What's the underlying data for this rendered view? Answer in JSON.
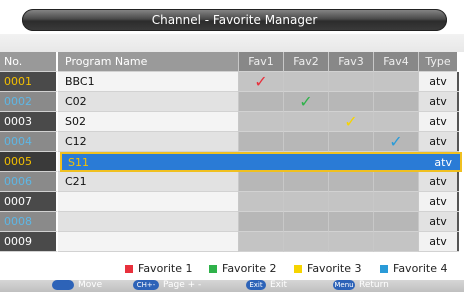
{
  "title": "Channel - Favorite Manager",
  "headers": {
    "no": "No.",
    "name": "Program Name",
    "fav1": "Fav1",
    "fav2": "Fav2",
    "fav3": "Fav3",
    "fav4": "Fav4",
    "type": "Type"
  },
  "rows": [
    {
      "no": "0001",
      "name": "BBC1",
      "type": "atv",
      "fav": [
        1,
        0,
        0,
        0
      ]
    },
    {
      "no": "0002",
      "name": "C02",
      "type": "atv",
      "fav": [
        0,
        1,
        0,
        0
      ]
    },
    {
      "no": "0003",
      "name": "S02",
      "type": "atv",
      "fav": [
        0,
        0,
        1,
        0
      ]
    },
    {
      "no": "0004",
      "name": "C12",
      "type": "atv",
      "fav": [
        0,
        0,
        0,
        1
      ]
    },
    {
      "no": "0005",
      "name": "S11",
      "type": "atv",
      "fav": [
        0,
        0,
        0,
        0
      ]
    },
    {
      "no": "0006",
      "name": "C21",
      "type": "atv",
      "fav": [
        0,
        0,
        0,
        0
      ]
    },
    {
      "no": "0007",
      "name": "",
      "type": "atv",
      "fav": [
        0,
        0,
        0,
        0
      ]
    },
    {
      "no": "0008",
      "name": "",
      "type": "atv",
      "fav": [
        0,
        0,
        0,
        0
      ]
    },
    {
      "no": "0009",
      "name": "",
      "type": "atv",
      "fav": [
        0,
        0,
        0,
        0
      ]
    }
  ],
  "selected_row": 4,
  "check_symbol": "✓",
  "colors": {
    "fav1": "#e8303c",
    "fav2": "#2fb24a",
    "fav3": "#f6d400",
    "fav4": "#2a9bd8",
    "selection_fill": "#2a7bd6",
    "selection_border": "#f0c020"
  },
  "legend": [
    {
      "label": "Favorite 1",
      "color": "#e8303c"
    },
    {
      "label": "Favorite 2",
      "color": "#2fb24a"
    },
    {
      "label": "Favorite 3",
      "color": "#f6d400"
    },
    {
      "label": "Favorite 4",
      "color": "#2a9bd8"
    }
  ],
  "hints": [
    {
      "key": "",
      "label": "Move"
    },
    {
      "key": "CH+-",
      "label": "Page + -"
    },
    {
      "key": "Exit",
      "label": "Exit"
    },
    {
      "key": "Menu",
      "label": "Return"
    }
  ]
}
